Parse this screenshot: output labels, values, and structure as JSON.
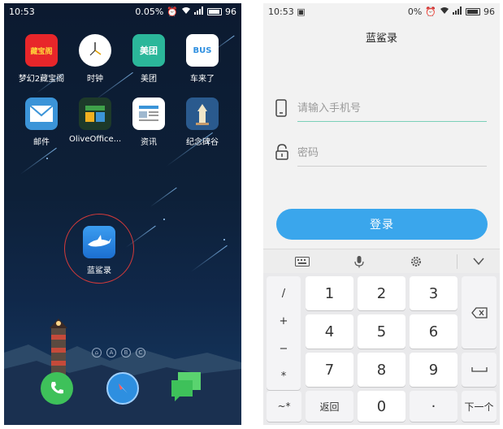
{
  "home": {
    "status": {
      "time": "10:53",
      "speed": "0.05",
      "speed_unit": "%",
      "battery": "96"
    },
    "apps": [
      {
        "label": "梦幻2藏宝阁",
        "icon_text": "藏宝阁",
        "icon": "treasure-icon",
        "color": "#e8262a"
      },
      {
        "label": "时钟",
        "icon_text": "",
        "icon": "clock-icon",
        "color": "#ffffff"
      },
      {
        "label": "美团",
        "icon_text": "美团",
        "icon": "meituan-icon",
        "color": "#2bb79a"
      },
      {
        "label": "车来了",
        "icon_text": "BUS",
        "icon": "bus-icon",
        "color": "#ffffff"
      },
      {
        "label": "邮件",
        "icon_text": "",
        "icon": "mail-icon",
        "color": "#3b94d8"
      },
      {
        "label": "OliveOffice...",
        "icon_text": "",
        "icon": "office-icon",
        "color": "#1d3a2a"
      },
      {
        "label": "资讯",
        "icon_text": "",
        "icon": "news-icon",
        "color": "#ffffff"
      },
      {
        "label": "纪念碑谷",
        "icon_text": "",
        "icon": "monument-icon",
        "color": "#2a5a8e"
      }
    ],
    "highlight_app": {
      "label": "蓝鲨录",
      "icon": "shark-icon",
      "color": "#2a86e0"
    },
    "page_dots": [
      "⌂",
      "A",
      "B",
      "C"
    ],
    "dock": [
      {
        "name": "phone-icon",
        "color": "#3ec15a"
      },
      {
        "name": "compass-icon",
        "color": "#2e8fe0"
      },
      {
        "name": "messages-icon",
        "color": "#3ec15a"
      }
    ]
  },
  "login": {
    "status": {
      "time": "10:53",
      "speed": "0",
      "speed_unit": "%",
      "battery": "96"
    },
    "title": "蓝鲨录",
    "phone_placeholder": "请输入手机号",
    "password_placeholder": "密码",
    "login_label": "登录",
    "keyboard": {
      "symbols": [
        "/",
        "+",
        "−",
        "*"
      ],
      "digits": [
        [
          "1",
          "2",
          "3"
        ],
        [
          "4",
          "5",
          "6"
        ],
        [
          "7",
          "8",
          "9"
        ]
      ],
      "bottom": {
        "sym": "~*",
        "back": "返回",
        "zero": "0",
        "dot": "·",
        "next": "下一个"
      }
    }
  }
}
